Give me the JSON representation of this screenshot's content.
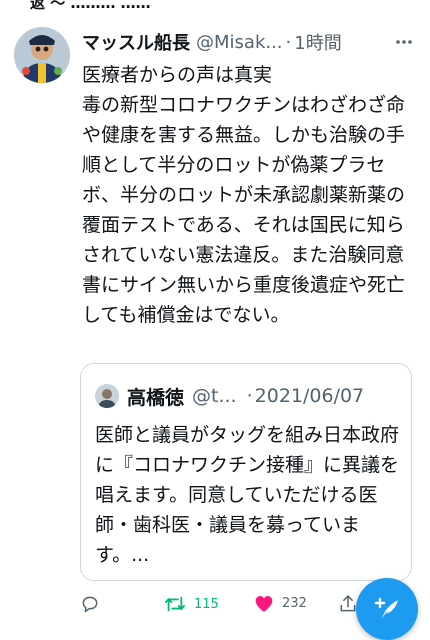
{
  "top_cut_text": "返  ～ ………  ……",
  "tweet": {
    "author_name": "マッスル船長",
    "author_handle": "@Misak...",
    "separator": "·",
    "time": "1時間",
    "more_icon": "more-icon",
    "text": "医療者からの声は真実\n毒の新型コロナワクチンはわざわざ命や健康を害する無益。しかも治験の手順として半分のロットが偽薬プラセボ、半分のロットが未承認劇薬新薬の覆面テストである、それは国民に知らされていない憲法違反。また治験同意書にサイン無いから重度後遺症や死亡しても補償金はでない。"
  },
  "quote": {
    "author_name": "高橋徳",
    "author_handle": "@t...",
    "separator": "·",
    "date": "2021/06/07",
    "text": "医師と議員がタッグを組み日本政府に『コロナワクチン接種』に異議を唱えます。同意していただける医師・歯科医・議員を募っています。..."
  },
  "actions": {
    "reply_icon": "reply-icon",
    "retweet_count": "115",
    "retweet_color": "#00ba7c",
    "like_count": "232",
    "like_color": "#f91880",
    "share_icon": "share-icon"
  },
  "compose": {
    "icon": "compose-icon",
    "color": "#1d9bf0"
  }
}
